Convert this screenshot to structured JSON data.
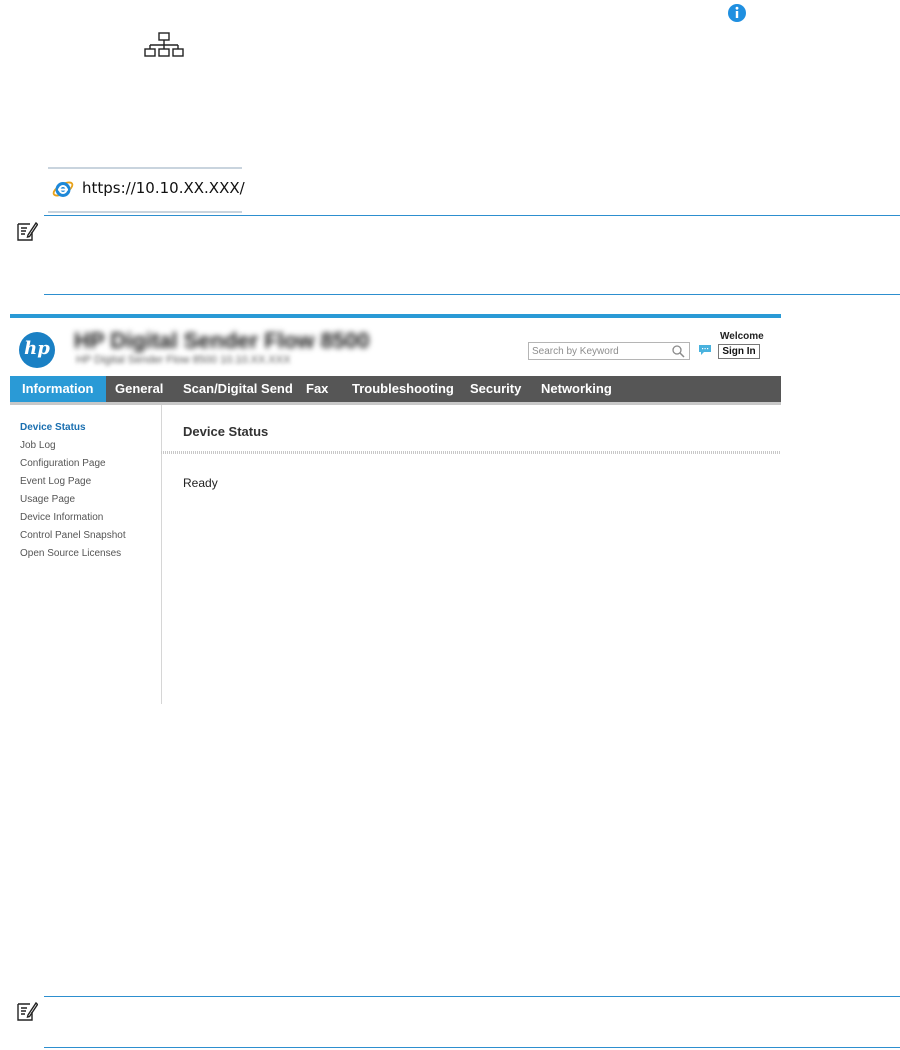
{
  "browser": {
    "url": "https://10.10.XX.XXX/"
  },
  "ews": {
    "product_title": "HP Digital Sender Flow 8500",
    "product_subtitle": "HP Digital Sender Flow 8500   10.10.XX.XXX",
    "search_placeholder": "Search by Keyword",
    "welcome_label": "Welcome",
    "sign_in_label": "Sign In",
    "tabs": [
      {
        "label": "Information"
      },
      {
        "label": "General"
      },
      {
        "label": "Scan/Digital Send"
      },
      {
        "label": "Fax"
      },
      {
        "label": "Troubleshooting"
      },
      {
        "label": "Security"
      },
      {
        "label": "Networking"
      }
    ],
    "sidebar": [
      {
        "label": "Device Status"
      },
      {
        "label": "Job Log"
      },
      {
        "label": "Configuration Page"
      },
      {
        "label": "Event Log Page"
      },
      {
        "label": "Usage Page"
      },
      {
        "label": "Device Information"
      },
      {
        "label": "Control Panel Snapshot"
      },
      {
        "label": "Open Source Licenses"
      }
    ],
    "main_title": "Device Status",
    "status_text": "Ready"
  },
  "colors": {
    "accent": "#2a9ad6",
    "nav_bg": "#565656",
    "hp_blue": "#1a80c4",
    "info_icon": "#1f8fe0"
  },
  "icons": {
    "info": "info-icon",
    "network": "network-icon",
    "browser": "internet-explorer-icon",
    "note": "note-icon",
    "search": "search-icon",
    "chat": "chat-icon"
  }
}
